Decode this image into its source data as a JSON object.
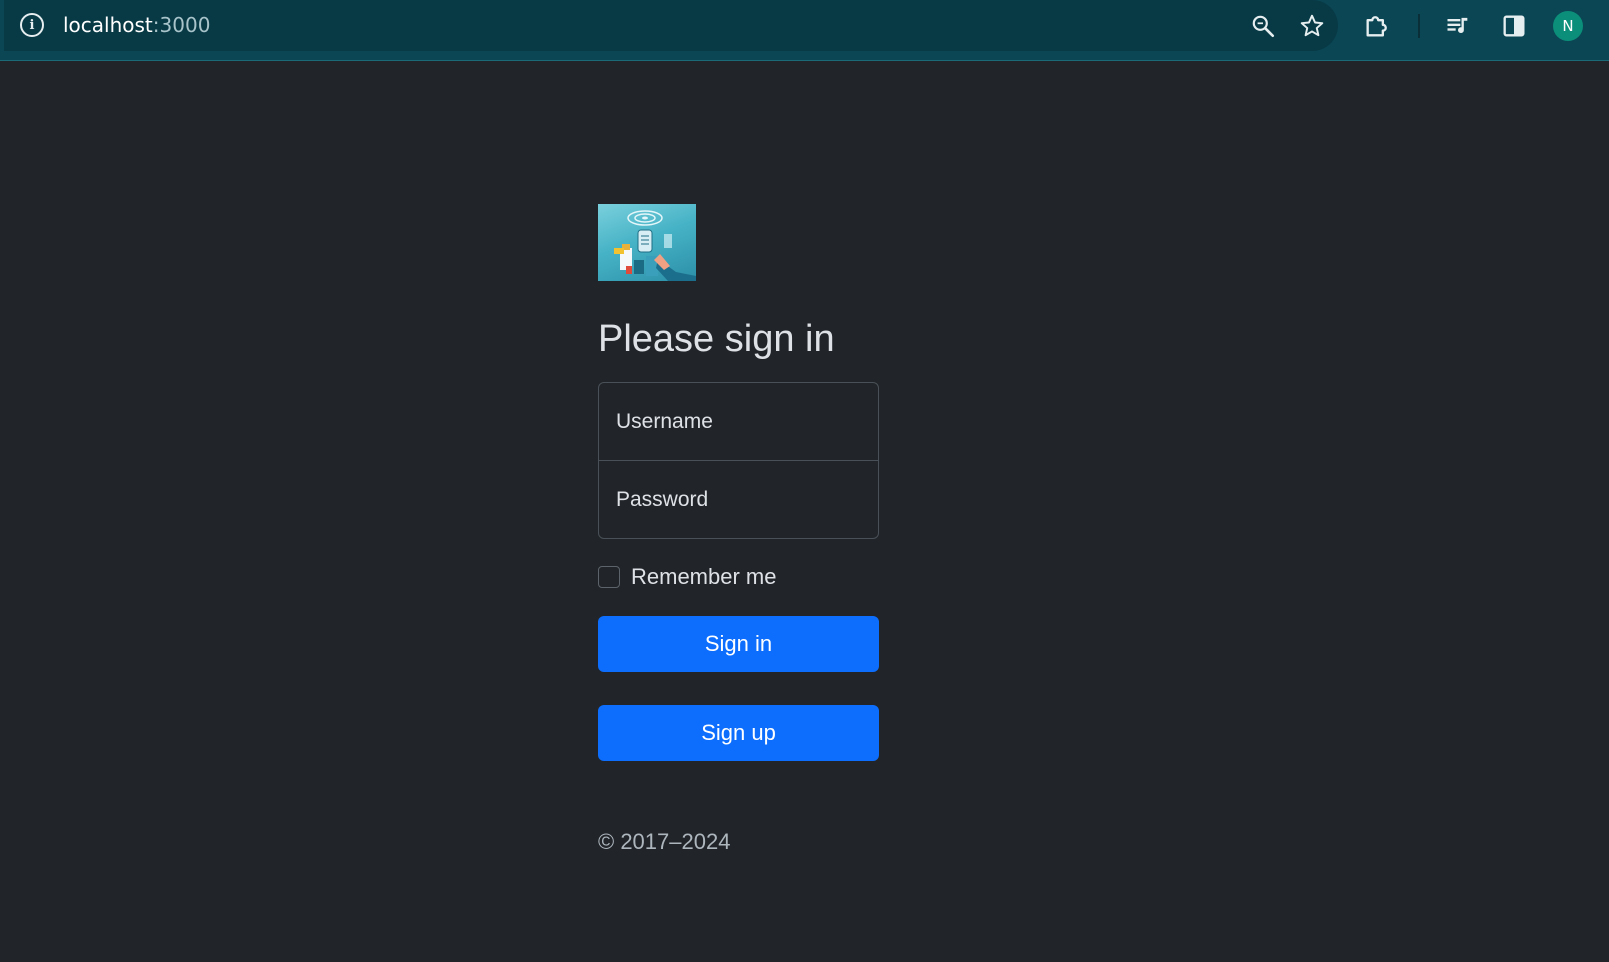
{
  "browser": {
    "url_host": "localhost",
    "url_port": ":3000",
    "info_icon": "info-icon",
    "icons": [
      "zoom-icon",
      "star-icon",
      "extensions-icon",
      "media-control-icon",
      "side-panel-icon"
    ],
    "profile_initial": "N"
  },
  "form": {
    "title": "Please sign in",
    "username_placeholder": "Username",
    "password_placeholder": "Password",
    "remember_label": "Remember me",
    "remember_checked": false,
    "signin_label": "Sign in",
    "signup_label": "Sign up",
    "copyright": "© 2017–2024"
  },
  "colors": {
    "page_background": "#212529",
    "primary_button": "#0d6efd",
    "browser_bar": "#0b4654"
  }
}
